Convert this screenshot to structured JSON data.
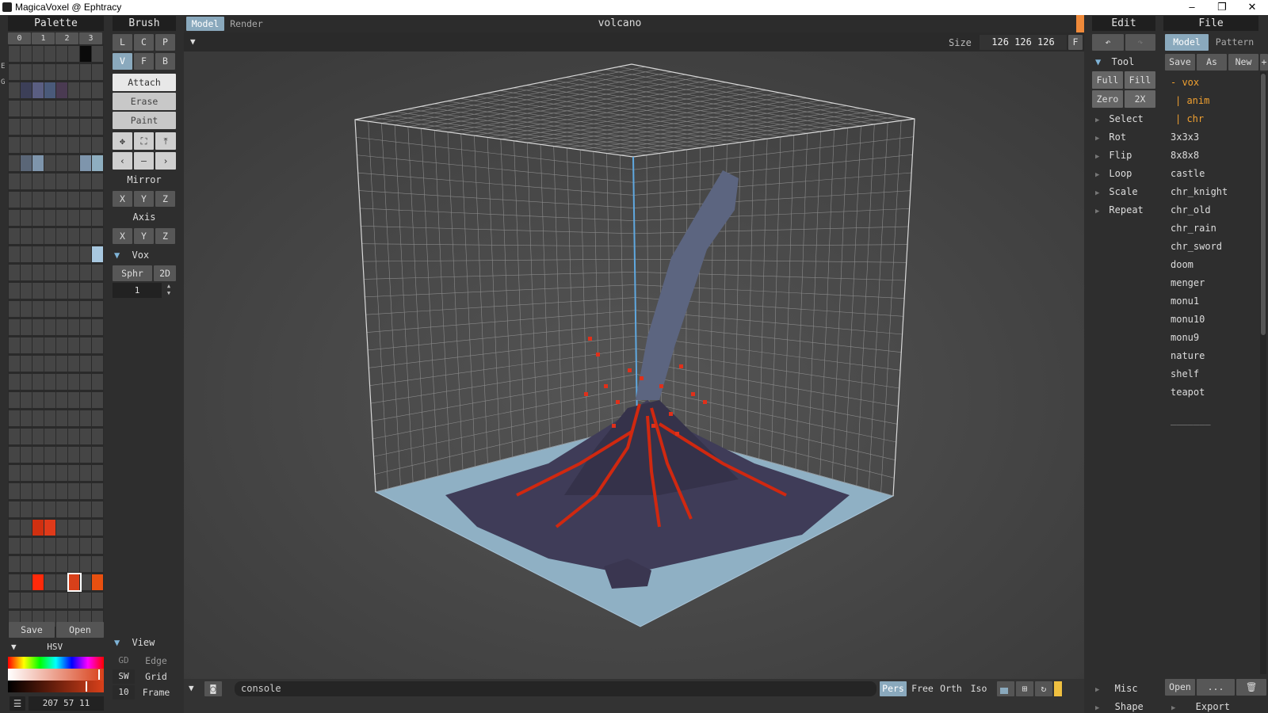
{
  "window": {
    "title": "MagicaVoxel @ Ephtracy",
    "min": "–",
    "max": "❐",
    "close": "✕"
  },
  "palette": {
    "header": "Palette",
    "tabs": [
      "0",
      "1",
      "2",
      "3"
    ],
    "side_letters": [
      "E",
      "G"
    ],
    "save": "Save",
    "open": "Open",
    "hsv_label": "HSV",
    "color_value": "207 57 11",
    "menu_icon": "menu-icon",
    "colors": {
      "r0c6": "#0a0a0a",
      "r2c1": "#3c3f58",
      "r2c2": "#5a5e82",
      "r2c3": "#4a5a7a",
      "r2c4": "#4a3a52",
      "r6c1": "#5a6677",
      "r6c2": "#7e95ac",
      "r6c6": "#7e95ac",
      "r6c7": "#8eaec0",
      "r11c7": "#a8c8e0",
      "r26c2": "#d03010",
      "r26c3": "#e03a1a",
      "r29c2": "#ff2a0a",
      "r29c5": "#d8401a",
      "r29c7": "#e85010"
    }
  },
  "brush": {
    "header": "Brush",
    "row1": [
      "L",
      "C",
      "P"
    ],
    "row2": [
      "V",
      "F",
      "B"
    ],
    "modes": [
      "Attach",
      "Erase",
      "Paint"
    ],
    "mirror": "Mirror",
    "mirror_axes": [
      "X",
      "Y",
      "Z"
    ],
    "axis": "Axis",
    "axis_axes": [
      "X",
      "Y",
      "Z"
    ],
    "vox": "Vox",
    "vox_shapes": [
      "Sphr",
      "2D"
    ],
    "size": "1",
    "view": "View",
    "view_rows": [
      {
        "k": "GD",
        "v": "Edge"
      },
      {
        "k": "SW",
        "v": "Grid"
      },
      {
        "k": "10",
        "v": "Frame"
      }
    ]
  },
  "viewport": {
    "tabs": [
      "Model",
      "Render"
    ],
    "title": "volcano",
    "size_label": "Size",
    "size_value": "126 126 126",
    "f_btn": "F",
    "console": "console",
    "modes": [
      "Pers",
      "Free",
      "Orth",
      "Iso"
    ],
    "accent": "#f08a3a",
    "active": "#7fb4d8"
  },
  "edit": {
    "header": "Edit",
    "tool": "Tool",
    "buttons": [
      "Full",
      "Fill",
      "Zero",
      "2X"
    ],
    "items": [
      "Select",
      "Rot",
      "Flip",
      "Loop",
      "Scale",
      "Repeat"
    ],
    "misc": "Misc",
    "shape": "Shape"
  },
  "file": {
    "header": "File",
    "tabs": [
      "Model",
      "Pattern"
    ],
    "actions": [
      "Save",
      "As",
      "New",
      "+"
    ],
    "tree": [
      "- vox",
      "| anim",
      "| chr"
    ],
    "files": [
      "3x3x3",
      "8x8x8",
      "castle",
      "chr_knight",
      "chr_old",
      "chr_rain",
      "chr_sword",
      "doom",
      "menger",
      "monu1",
      "monu10",
      "monu9",
      "nature",
      "shelf",
      "teapot"
    ],
    "sep": "_______",
    "open": "Open",
    "more": "...",
    "export": "Export"
  }
}
